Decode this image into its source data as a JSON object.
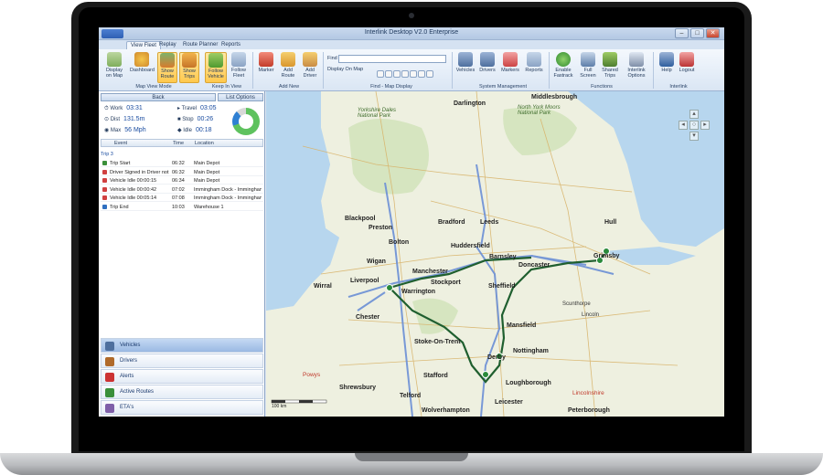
{
  "window": {
    "title": "Interlink Desktop V2.0 Enterprise",
    "controls": [
      "–",
      "□",
      "✕"
    ]
  },
  "tabs": [
    "View Fleet",
    "Replay",
    "Route Planner",
    "Reports"
  ],
  "ribbon": {
    "buttons": [
      {
        "label": "Display on Map",
        "icon": "map-icon"
      },
      {
        "label": "Dashboard",
        "icon": "dashboard-icon"
      },
      {
        "label": "Show Route",
        "icon": "route-icon",
        "active": true
      },
      {
        "label": "Show Trips",
        "icon": "trips-icon",
        "active": true
      },
      {
        "label": "Follow Vehicle",
        "icon": "follow-icon",
        "active": true
      },
      {
        "label": "Follow Fleet",
        "icon": "fleet-icon"
      },
      {
        "label": "Marker",
        "icon": "marker-icon"
      },
      {
        "label": "Add Route",
        "icon": "add-route-icon"
      },
      {
        "label": "Add Driver",
        "icon": "add-driver-icon"
      },
      {
        "label": "Vehicles",
        "icon": "vehicles-icon"
      },
      {
        "label": "Drivers",
        "icon": "drivers-icon"
      },
      {
        "label": "Markers",
        "icon": "markers-icon"
      },
      {
        "label": "Reports",
        "icon": "reports-icon"
      },
      {
        "label": "Enable Fastrack",
        "icon": "fastrack-icon"
      },
      {
        "label": "Full Screen",
        "icon": "fullscreen-icon"
      },
      {
        "label": "Shared Trips",
        "icon": "shared-trips-icon"
      },
      {
        "label": "Interlink Options",
        "icon": "options-icon"
      },
      {
        "label": "Help",
        "icon": "help-icon"
      },
      {
        "label": "Logout",
        "icon": "logout-icon"
      }
    ],
    "groups": [
      "Map View Mode",
      "Keep In View",
      "Add New",
      "Find - Map Display",
      "System Management",
      "Functions",
      "Interlink"
    ],
    "find_label": "Find",
    "display_on_map": "Display On Map"
  },
  "left": {
    "back": "Back",
    "list_options": "List Options",
    "stats": [
      {
        "label": "Work",
        "value": "03:31"
      },
      {
        "label": "Dist",
        "value": "131.5m"
      },
      {
        "label": "Max",
        "value": "56 Mph"
      },
      {
        "label": "Travel",
        "value": "03:05"
      },
      {
        "label": "Stop",
        "value": "00:26"
      },
      {
        "label": "Idle",
        "value": "00:18"
      }
    ],
    "columns": [
      "Event",
      "Time",
      "Location"
    ],
    "trip_label": "Trip 3",
    "events": [
      {
        "event": "Trip Start",
        "time": "06:32",
        "location": "Main Depot",
        "color": "#3a8f3a"
      },
      {
        "event": "Driver Signed in Driver not p",
        "time": "06:32",
        "location": "Main Depot",
        "color": "#d04040"
      },
      {
        "event": "Vehicle Idle 00:00:15",
        "time": "06:34",
        "location": "Main Depot",
        "color": "#d04040"
      },
      {
        "event": "Vehicle Idle 00:00:42",
        "time": "07:02",
        "location": "Immingham Dock - Immingham - ",
        "color": "#d04040"
      },
      {
        "event": "Vehicle Idle 00:05:14",
        "time": "07:08",
        "location": "Immingham Dock - Immingham - ",
        "color": "#d04040"
      },
      {
        "event": "Trip End",
        "time": "10:03",
        "location": "Warehouse 1",
        "color": "#2f6fc0"
      }
    ],
    "nav": [
      {
        "label": "Vehicles",
        "icon": "truck-icon",
        "selected": true
      },
      {
        "label": "Drivers",
        "icon": "driver-icon"
      },
      {
        "label": "Alerts",
        "icon": "alert-icon"
      },
      {
        "label": "Active Routes",
        "icon": "routes-icon"
      },
      {
        "label": "ETA's",
        "icon": "eta-icon"
      }
    ]
  },
  "map": {
    "places": [
      {
        "name": "Darlington"
      },
      {
        "name": "Middlesbrough"
      },
      {
        "name": "Yorkshire Dales National Park"
      },
      {
        "name": "North York Moors National Park"
      },
      {
        "name": "Blackpool"
      },
      {
        "name": "Preston"
      },
      {
        "name": "Bradford"
      },
      {
        "name": "Leeds"
      },
      {
        "name": "Hull"
      },
      {
        "name": "Huddersfield"
      },
      {
        "name": "Bolton"
      },
      {
        "name": "Wigan"
      },
      {
        "name": "Barnsley"
      },
      {
        "name": "Doncaster"
      },
      {
        "name": "Grimsby"
      },
      {
        "name": "Manchester"
      },
      {
        "name": "Liverpool"
      },
      {
        "name": "Stockport"
      },
      {
        "name": "Wirral"
      },
      {
        "name": "Warrington"
      },
      {
        "name": "Sheffield"
      },
      {
        "name": "Chester"
      },
      {
        "name": "Mansfield"
      },
      {
        "name": "Stoke-On-Trent"
      },
      {
        "name": "Nottingham"
      },
      {
        "name": "Derby"
      },
      {
        "name": "Stafford"
      },
      {
        "name": "Loughborough"
      },
      {
        "name": "Shrewsbury"
      },
      {
        "name": "Telford"
      },
      {
        "name": "Leicester"
      },
      {
        "name": "Wolverhampton"
      },
      {
        "name": "Peterborough"
      },
      {
        "name": "Powys"
      },
      {
        "name": "Lincolnshire"
      },
      {
        "name": "Scunthorpe"
      },
      {
        "name": "Lincoln"
      }
    ],
    "scale_label": "100 km"
  },
  "colors": {
    "route": "#1f5f2f",
    "motorway": "#6b8fd6",
    "land": "#eef0e0",
    "water": "#b7d6ee"
  }
}
